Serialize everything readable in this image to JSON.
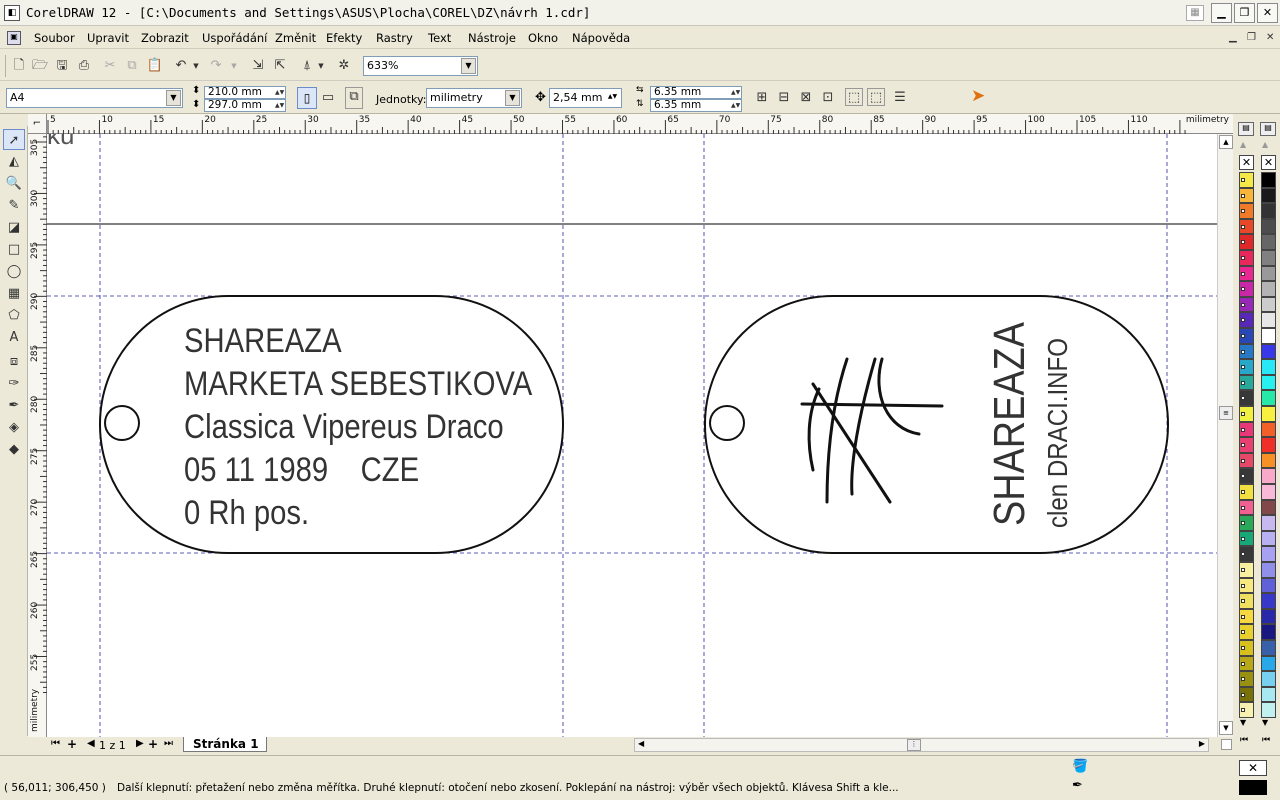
{
  "window": {
    "title": "CorelDRAW 12 - [C:\\Documents and Settings\\ASUS\\Plocha\\COREL\\DZ\\návrh 1.cdr]",
    "app_icon": "coreldraw-icon"
  },
  "menu": [
    "Soubor",
    "Upravit",
    "Zobrazit",
    "Uspořádání",
    "Změnit",
    "Efekty",
    "Rastry",
    "Text",
    "Nástroje",
    "Okno",
    "Nápověda"
  ],
  "toolbar": {
    "zoom": "633%"
  },
  "property_bar": {
    "paper_size": "A4",
    "width": "210.0 mm",
    "height": "297.0 mm",
    "units_label": "Jednotky:",
    "units": "milimetry",
    "nudge": "2,54 mm",
    "dup_x": "6.35 mm",
    "dup_y": "6.35 mm"
  },
  "rulers": {
    "h_ticks": [
      "5",
      "10",
      "15",
      "20",
      "25",
      "30",
      "35",
      "40",
      "45",
      "50",
      "55",
      "60",
      "65",
      "70",
      "75",
      "80",
      "85",
      "90",
      "95",
      "100",
      "105",
      "110"
    ],
    "h_unit": "milimetry",
    "v_ticks": [
      "305",
      "300",
      "295",
      "290",
      "285",
      "280",
      "275",
      "270",
      "265",
      "260",
      "255"
    ],
    "v_unit": "milimetry"
  },
  "canvas": {
    "corner_text": "ku",
    "tag_left_lines": [
      "SHAREAZA",
      "MARKETA SEBESTIKOVA",
      "Classica Vipereus Draco",
      "05 11 1989    CZE",
      "0 Rh pos."
    ],
    "tag_right_title": "SHAREAZA",
    "tag_right_subtitle": "clen DRACI.INFO"
  },
  "pages": {
    "counter": "1 z 1",
    "tab": "Stránka 1"
  },
  "status": {
    "coords": "( 56,011; 306,450 )",
    "message": "Další klepnutí: přetažení nebo změna měřítka. Druhé klepnutí: otočení  nebo zkosení. Poklepání na nástroj: výběr všech objektů. Klávesa Shift a kle..."
  },
  "palette_colors_left": [
    "#f5e94a",
    "#f7b63a",
    "#f07a28",
    "#e84828",
    "#e02828",
    "#e8285a",
    "#e82890",
    "#c828a8",
    "#9828b8",
    "#5828b8",
    "#2848b8",
    "#2878c8",
    "#28a8c8",
    "#28a898",
    "#383838",
    "#f0f040",
    "#e83878",
    "#e84070",
    "#e84868",
    "#383838",
    "#f0e040",
    "#f06090",
    "#28a858",
    "#18a878",
    "#383838",
    "#f8f0a0",
    "#f8e880",
    "#f0e060",
    "#f8d840",
    "#e8d030",
    "#d8c020",
    "#b8a818",
    "#989010",
    "#787008",
    "#f8f0b0"
  ],
  "palette_colors_right": [
    "#000000",
    "#1a1a1a",
    "#333333",
    "#4d4d4d",
    "#666666",
    "#808080",
    "#999999",
    "#b3b3b3",
    "#cccccc",
    "#e6e6e6",
    "#ffffff",
    "#3838e8",
    "#28e8f8",
    "#28f0f0",
    "#28e8a8",
    "#f8f040",
    "#f06028",
    "#f03028",
    "#f89028",
    "#f8a8c8",
    "#f8b8d8",
    "#804848",
    "#c8b8f0",
    "#b8b0f0",
    "#a8a0f0",
    "#9090e8",
    "#6060d8",
    "#3838c8",
    "#2828a8",
    "#181880",
    "#3860a8",
    "#28a8e8",
    "#78d0f0",
    "#a8e8f0",
    "#c0f0f0"
  ]
}
